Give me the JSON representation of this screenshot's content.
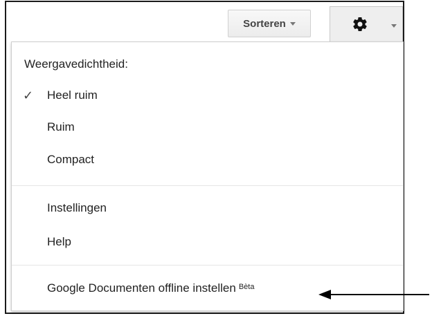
{
  "toolbar": {
    "sort_label": "Sorteren",
    "settings_icon": "gear-icon"
  },
  "menu": {
    "density_title": "Weergavedichtheid:",
    "density_options": [
      {
        "label": "Heel ruim",
        "checked": true
      },
      {
        "label": "Ruim",
        "checked": false
      },
      {
        "label": "Compact",
        "checked": false
      }
    ],
    "check_glyph": "✓",
    "settings_label": "Instellingen",
    "help_label": "Help",
    "offline_label": "Google Documenten offline instellen",
    "beta_badge": "Bèta"
  },
  "annotation": {
    "arrow": "left-arrow pointing at offline item"
  }
}
